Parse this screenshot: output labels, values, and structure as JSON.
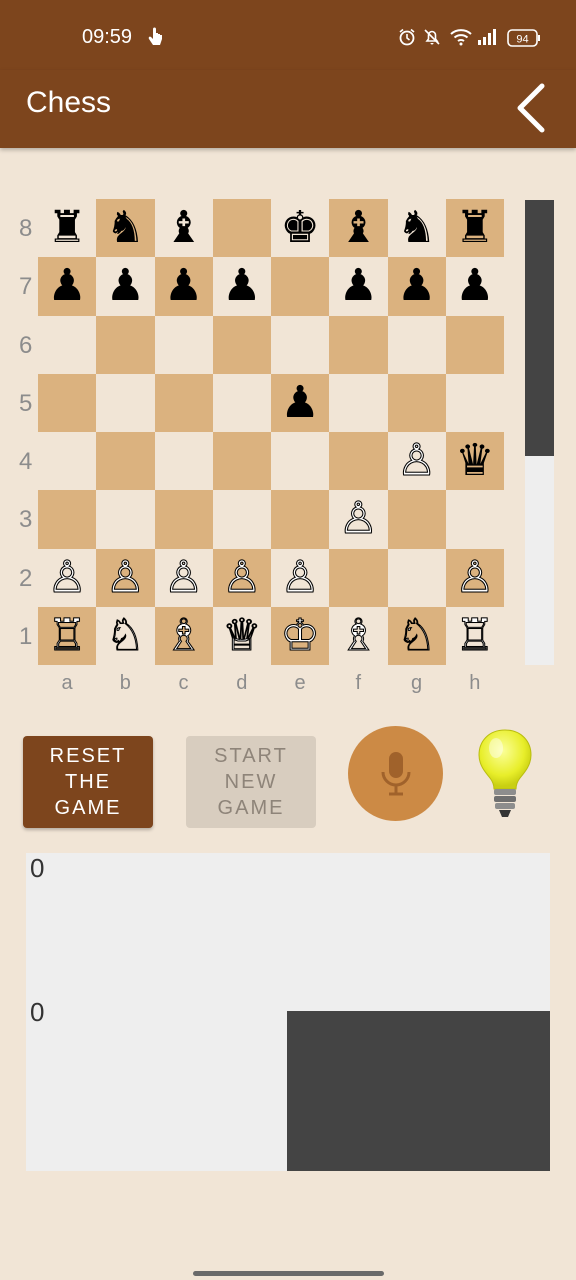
{
  "status": {
    "time": "09:59",
    "battery": "94"
  },
  "app": {
    "title": "Chess"
  },
  "board": {
    "rows": [
      [
        "♜",
        "♞",
        "♝",
        "",
        "♚",
        "♝",
        "♞",
        "♜"
      ],
      [
        "♟",
        "♟",
        "♟",
        "♟",
        "",
        "♟",
        "♟",
        "♟"
      ],
      [
        "",
        "",
        "",
        "",
        "",
        "",
        "",
        ""
      ],
      [
        "",
        "",
        "",
        "",
        "♟",
        "",
        "",
        ""
      ],
      [
        "",
        "",
        "",
        "",
        "",
        "",
        "♙",
        "♛"
      ],
      [
        "",
        "",
        "",
        "",
        "",
        "♙",
        "",
        ""
      ],
      [
        "♙",
        "♙",
        "♙",
        "♙",
        "♙",
        "",
        "",
        "♙"
      ],
      [
        "♖",
        "♘",
        "♗",
        "♕",
        "♔",
        "♗",
        "♘",
        "♖"
      ]
    ],
    "ranks": [
      "8",
      "7",
      "6",
      "5",
      "4",
      "3",
      "2",
      "1"
    ],
    "files": [
      "a",
      "b",
      "c",
      "d",
      "e",
      "f",
      "g",
      "h"
    ]
  },
  "scrollbar": {
    "position_fraction": 0.55
  },
  "buttons": {
    "reset": "RESET\nTHE\nGAME",
    "start": "START\nNEW\nGAME"
  },
  "icons": {
    "mic": "mic-icon",
    "hint": "light-bulb-icon",
    "back": "back-arrow-icon"
  },
  "scores": {
    "top": "0",
    "bottom": "0"
  },
  "colors": {
    "brand": "#7d451d",
    "background": "#f1e5d6",
    "dark_square": "#dbb27f",
    "light_square": "#f1e5d6",
    "mic": "#cc8a45",
    "panel": "#eeeeee",
    "panel_dark": "#444444"
  }
}
